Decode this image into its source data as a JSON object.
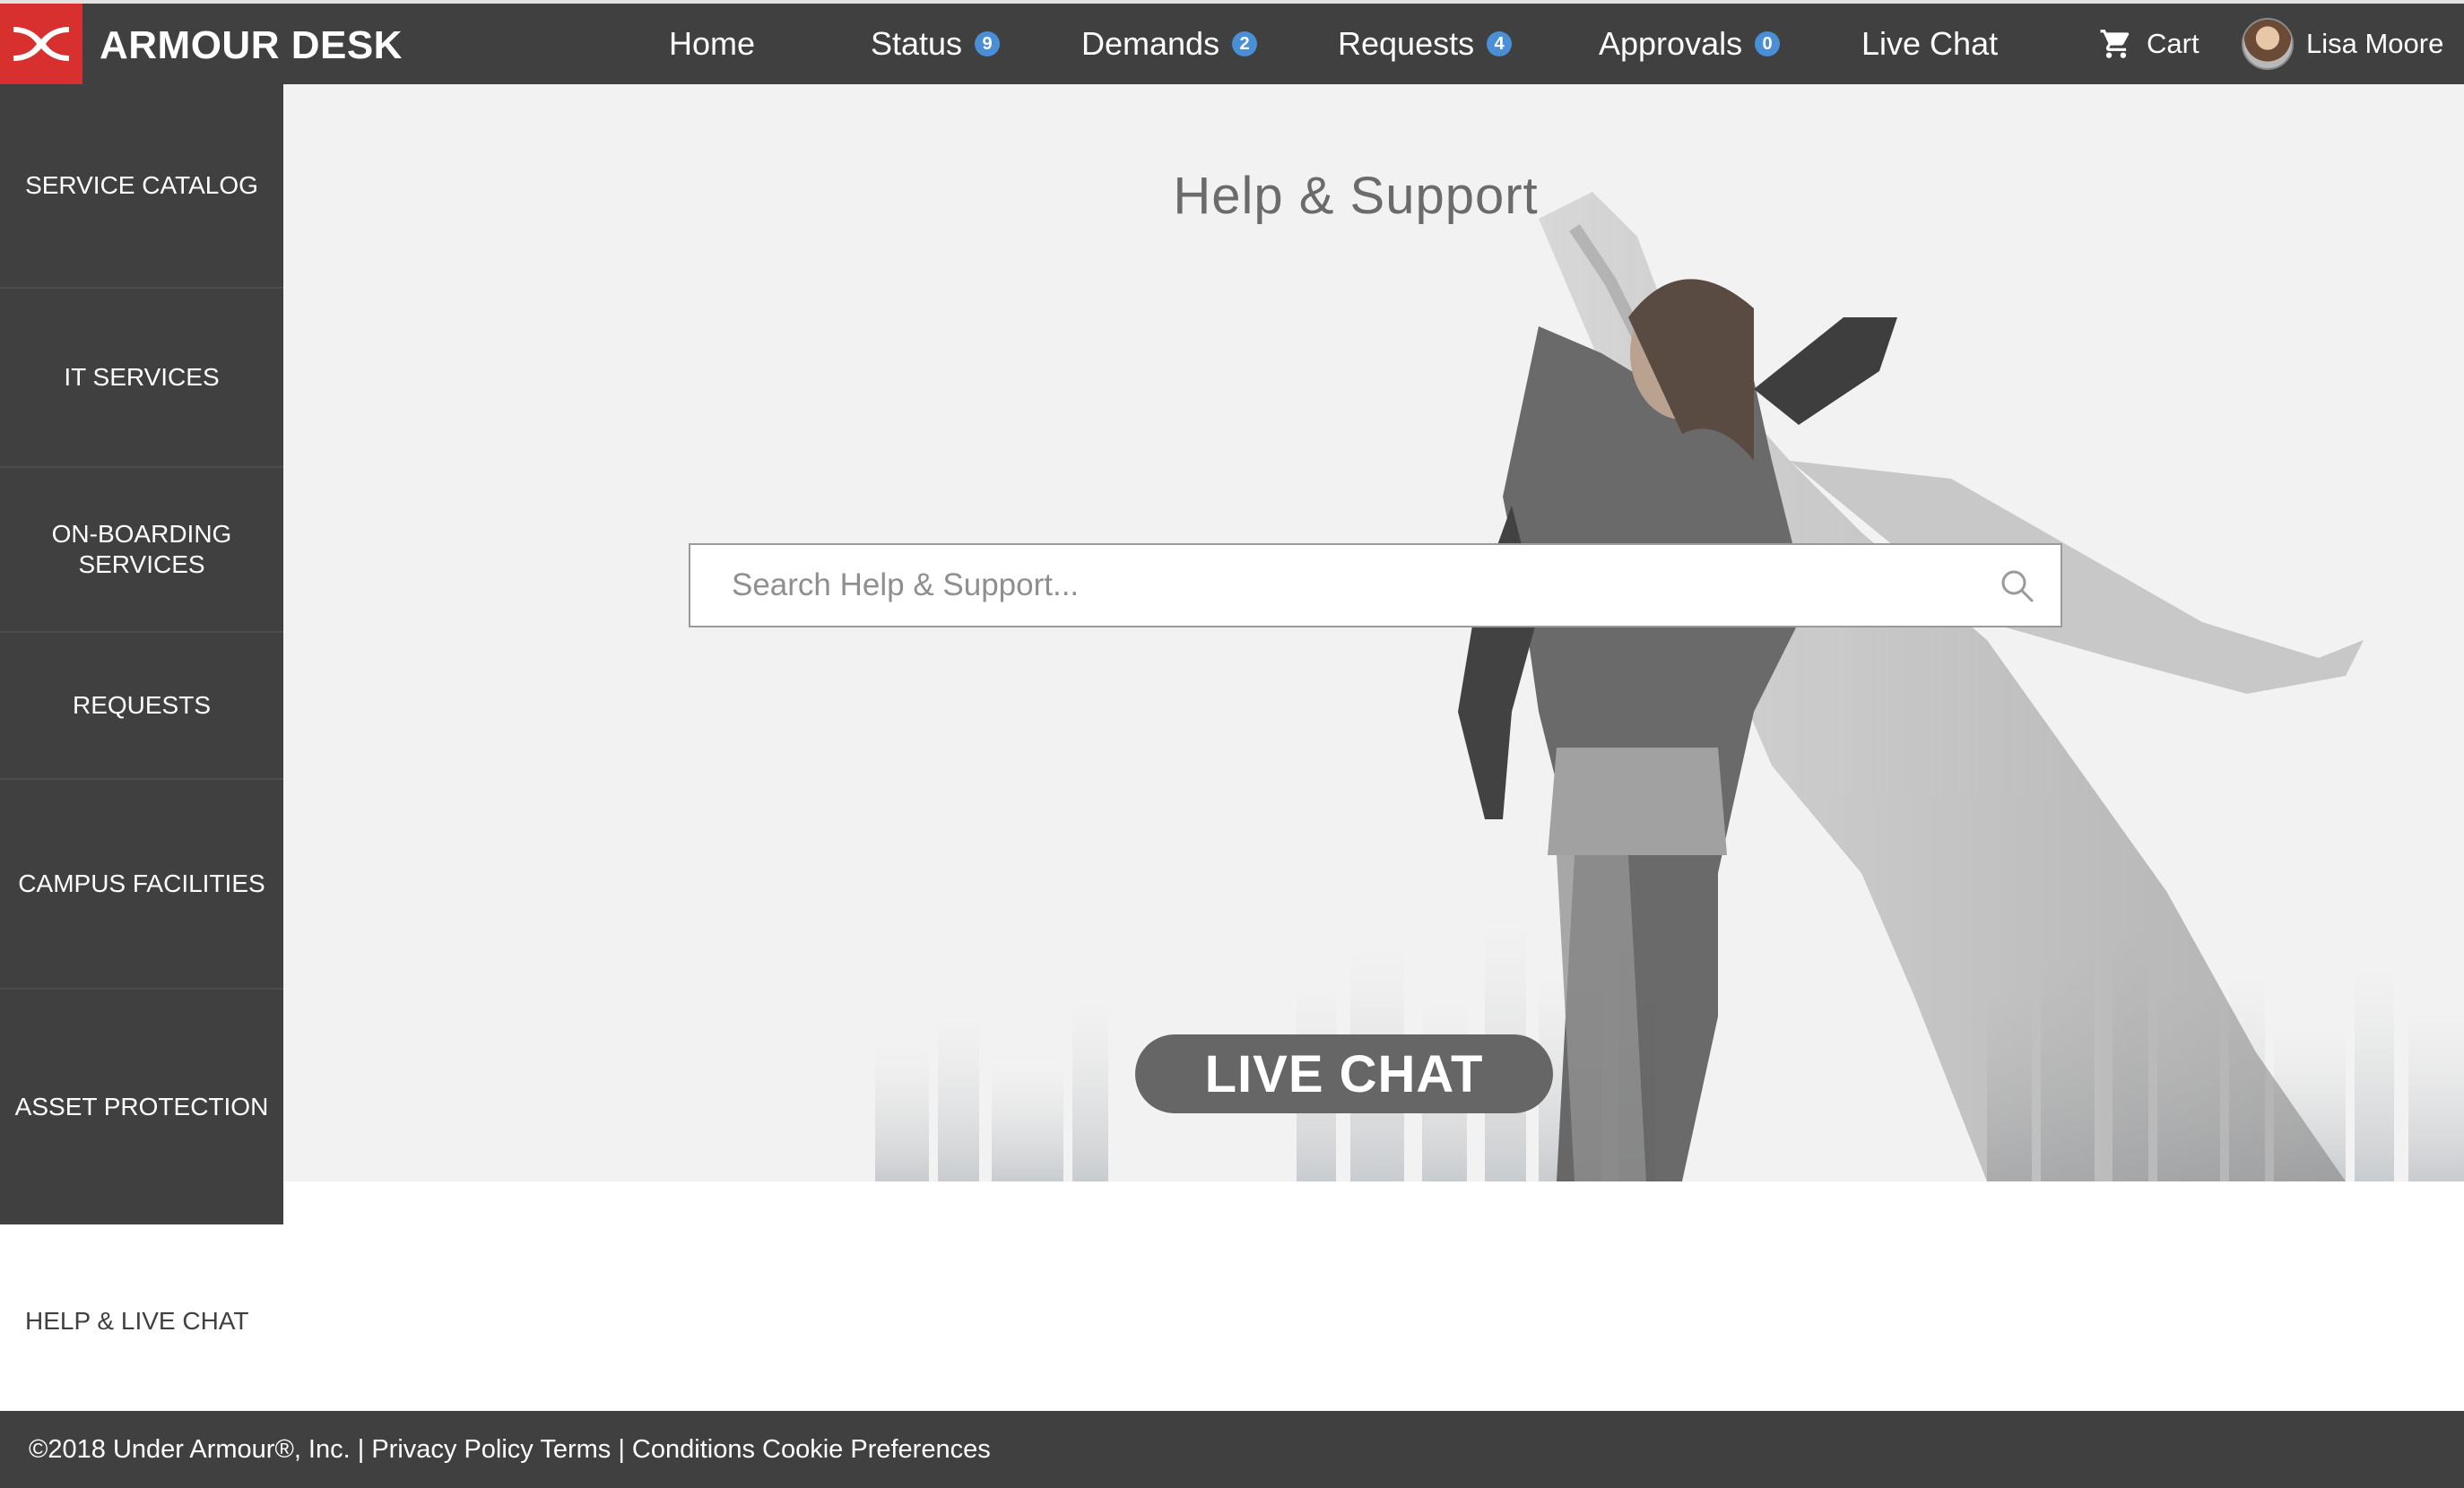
{
  "brand": {
    "name": "ARMOUR DESK",
    "accent": "#d8302f"
  },
  "nav": {
    "items": [
      {
        "label": "Home"
      },
      {
        "label": "Status",
        "badge": "9"
      },
      {
        "label": "Demands",
        "badge": "2"
      },
      {
        "label": "Requests",
        "badge": "4"
      },
      {
        "label": "Approvals",
        "badge": "0"
      },
      {
        "label": "Live Chat"
      }
    ],
    "cart_label": "Cart",
    "user_name": "Lisa Moore"
  },
  "sidebar": {
    "items": [
      {
        "label": "SERVICE CATALOG"
      },
      {
        "label": "IT SERVICES"
      },
      {
        "label": "ON-BOARDING SERVICES"
      },
      {
        "label": "REQUESTS"
      },
      {
        "label": "CAMPUS FACILITIES"
      },
      {
        "label": "ASSET PROTECTION"
      }
    ],
    "help_label": "HELP & LIVE CHAT"
  },
  "hero": {
    "title": "Help & Support",
    "search_placeholder": "Search Help & Support...",
    "live_chat_label": "LIVE CHAT"
  },
  "footer": {
    "text": "©2018 Under Armour®, Inc. | Privacy Policy Terms | Conditions Cookie Preferences"
  },
  "icons": [
    "under-armour-logo-icon",
    "cart-icon",
    "avatar",
    "search-icon"
  ],
  "colors": {
    "bar": "#404040",
    "badge": "#4a8fd6",
    "hero_bg": "#f2f2f2",
    "button": "#666666"
  }
}
